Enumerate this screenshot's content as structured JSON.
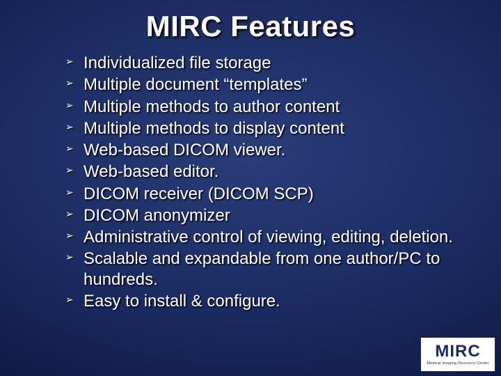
{
  "title": "MIRC Features",
  "bullets": [
    "Individualized file storage",
    "Multiple document “templates”",
    "Multiple methods to author content",
    "Multiple methods to display content",
    "Web-based DICOM viewer.",
    "Web-based editor.",
    "DICOM receiver (DICOM SCP)",
    "DICOM anonymizer",
    "Administrative control of viewing, editing, deletion.",
    "Scalable and expandable from one author/PC to hundreds.",
    "Easy to install & configure."
  ],
  "logo": {
    "main": "MIRC",
    "sub": "Medical Imaging Resource Center"
  }
}
